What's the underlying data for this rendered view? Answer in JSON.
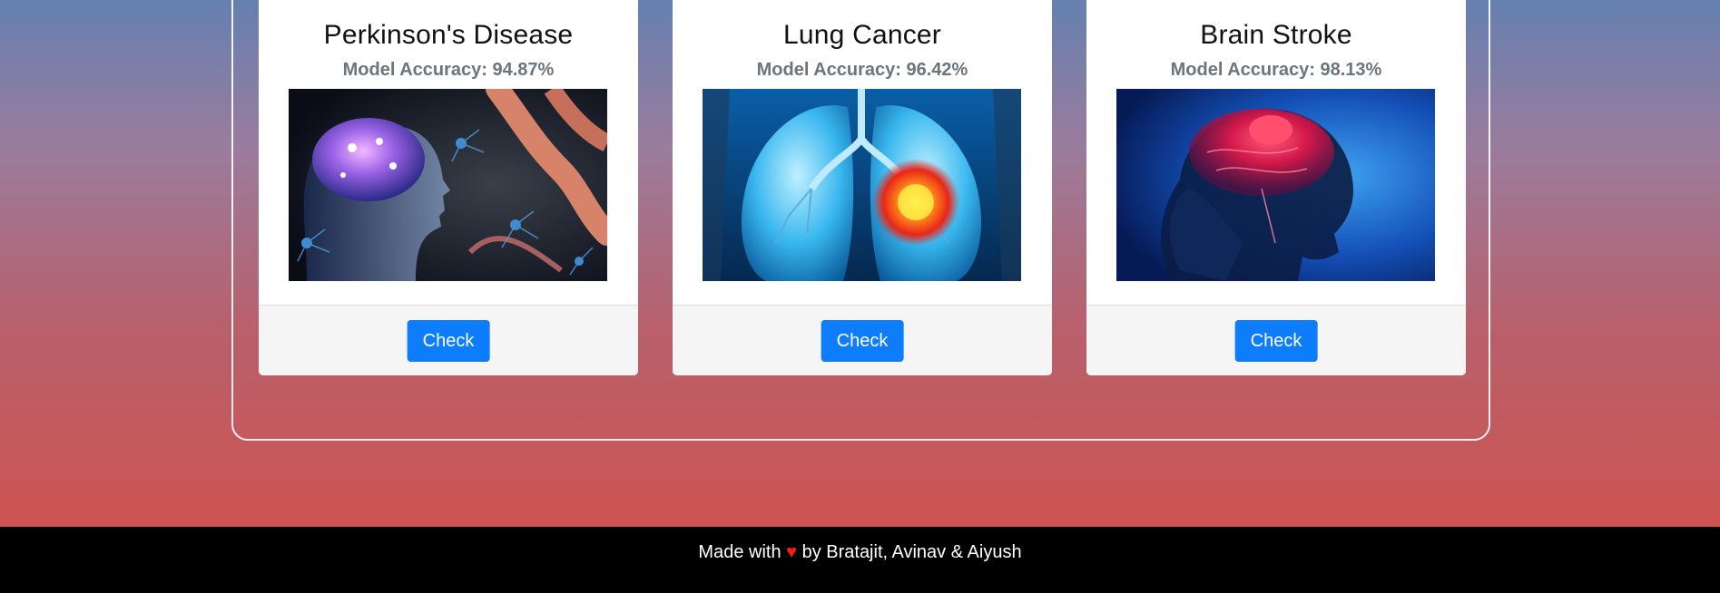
{
  "cards": [
    {
      "title": "Perkinson's Disease",
      "accuracy": "Model Accuracy: 94.87%",
      "image_alt": "brain-neurons-image",
      "button_label": "Check"
    },
    {
      "title": "Lung Cancer",
      "accuracy": "Model Accuracy: 96.42%",
      "image_alt": "lungs-tumor-image",
      "button_label": "Check"
    },
    {
      "title": "Brain Stroke",
      "accuracy": "Model Accuracy: 98.13%",
      "image_alt": "brain-stroke-image",
      "button_label": "Check"
    }
  ],
  "footer": {
    "prefix": "Made with",
    "heart": "♥",
    "suffix": "by Bratajit, Avinav & Aiyush"
  },
  "colors": {
    "button": "#0d7dfb",
    "heart": "#ff1a1a",
    "footer_bg": "#000000"
  }
}
